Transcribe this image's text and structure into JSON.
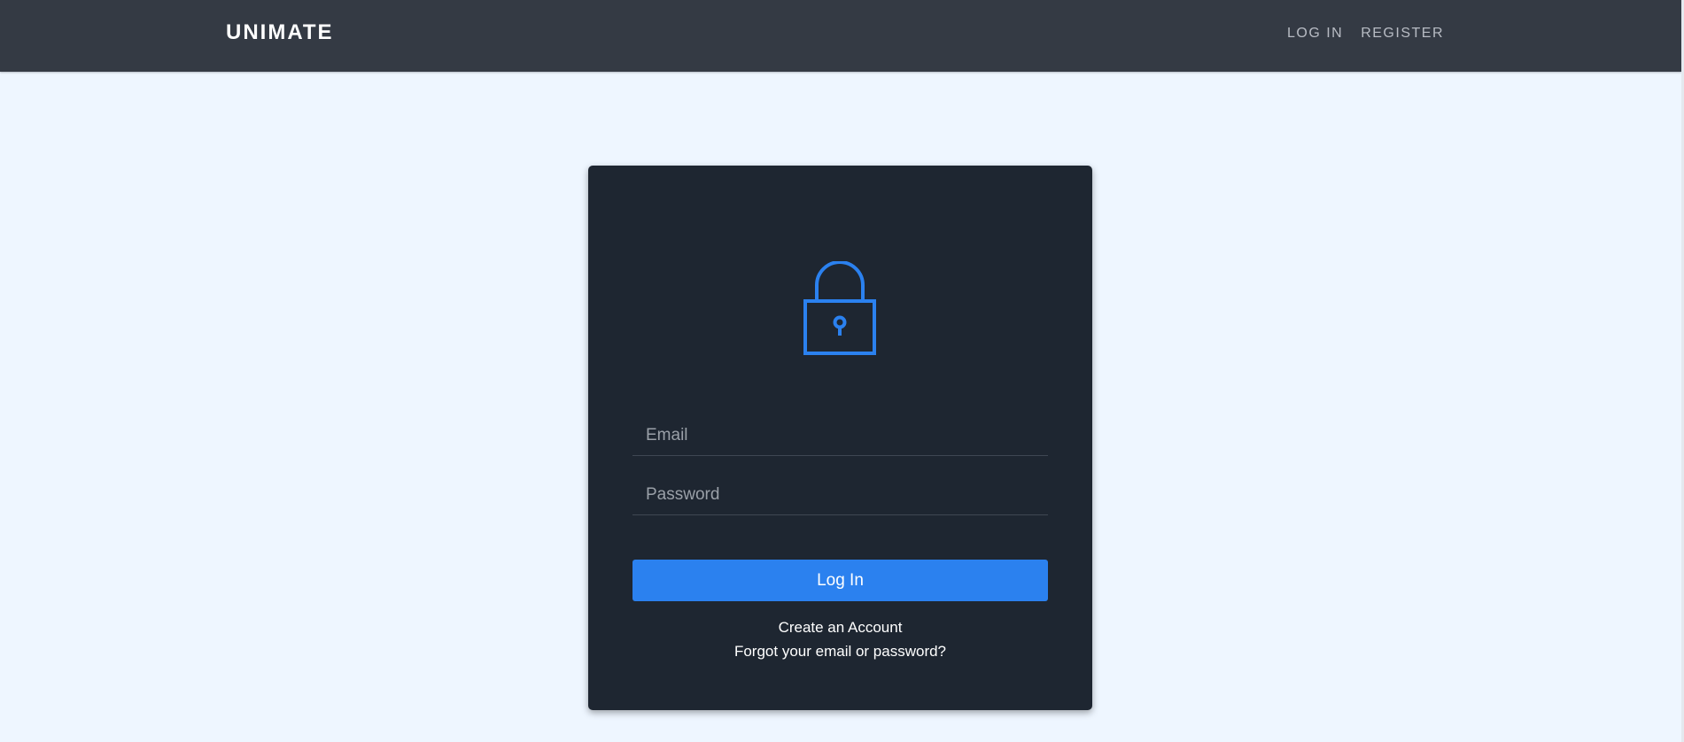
{
  "navbar": {
    "brand": "UNIMATE",
    "links": [
      "LOG IN",
      "REGISTER"
    ]
  },
  "login_form": {
    "email_placeholder": "Email",
    "password_placeholder": "Password",
    "submit_label": "Log In",
    "create_account": "Create an Account",
    "forgot": "Forgot your email or password?"
  },
  "icons": {
    "lock": "lock-icon"
  },
  "colors": {
    "page_background": "#eef6ff",
    "navbar": "#343a44",
    "card": "#1e2631",
    "accent": "#2b81ef"
  }
}
